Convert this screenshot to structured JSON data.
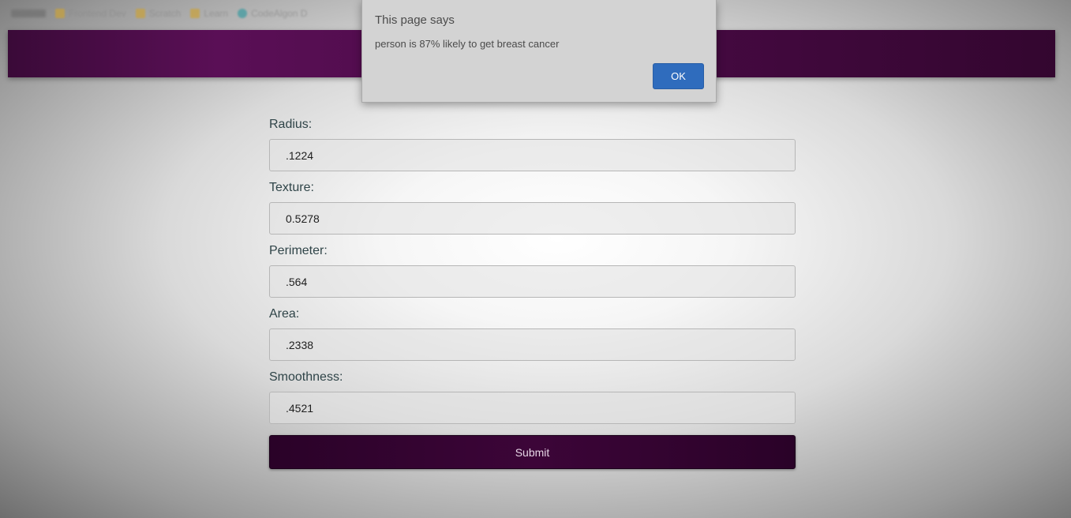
{
  "bookmarks": [
    {
      "label": "",
      "icon": "apps-icon"
    },
    {
      "label": "Frontend Dev",
      "icon": "folder-icon",
      "color": "#caa23a"
    },
    {
      "label": "Scratch",
      "icon": "folder-icon",
      "color": "#caa23a"
    },
    {
      "label": "Learn",
      "icon": "folder-icon",
      "color": "#caa23a"
    },
    {
      "label": "CodeAlgon D",
      "icon": "globe-icon",
      "color": "#3a9aa0"
    }
  ],
  "header": {
    "color": "#4a0a46"
  },
  "form": {
    "fields": [
      {
        "label": "Radius:",
        "value": ".1224"
      },
      {
        "label": "Texture:",
        "value": "0.5278"
      },
      {
        "label": "Perimeter:",
        "value": ".564"
      },
      {
        "label": "Area:",
        "value": ".2338"
      },
      {
        "label": "Smoothness:",
        "value": ".4521"
      }
    ],
    "submit_label": "Submit"
  },
  "alert": {
    "title": "This page says",
    "message": "person is 87% likely to get breast cancer",
    "ok_label": "OK",
    "ok_color": "#2f6cbd"
  }
}
